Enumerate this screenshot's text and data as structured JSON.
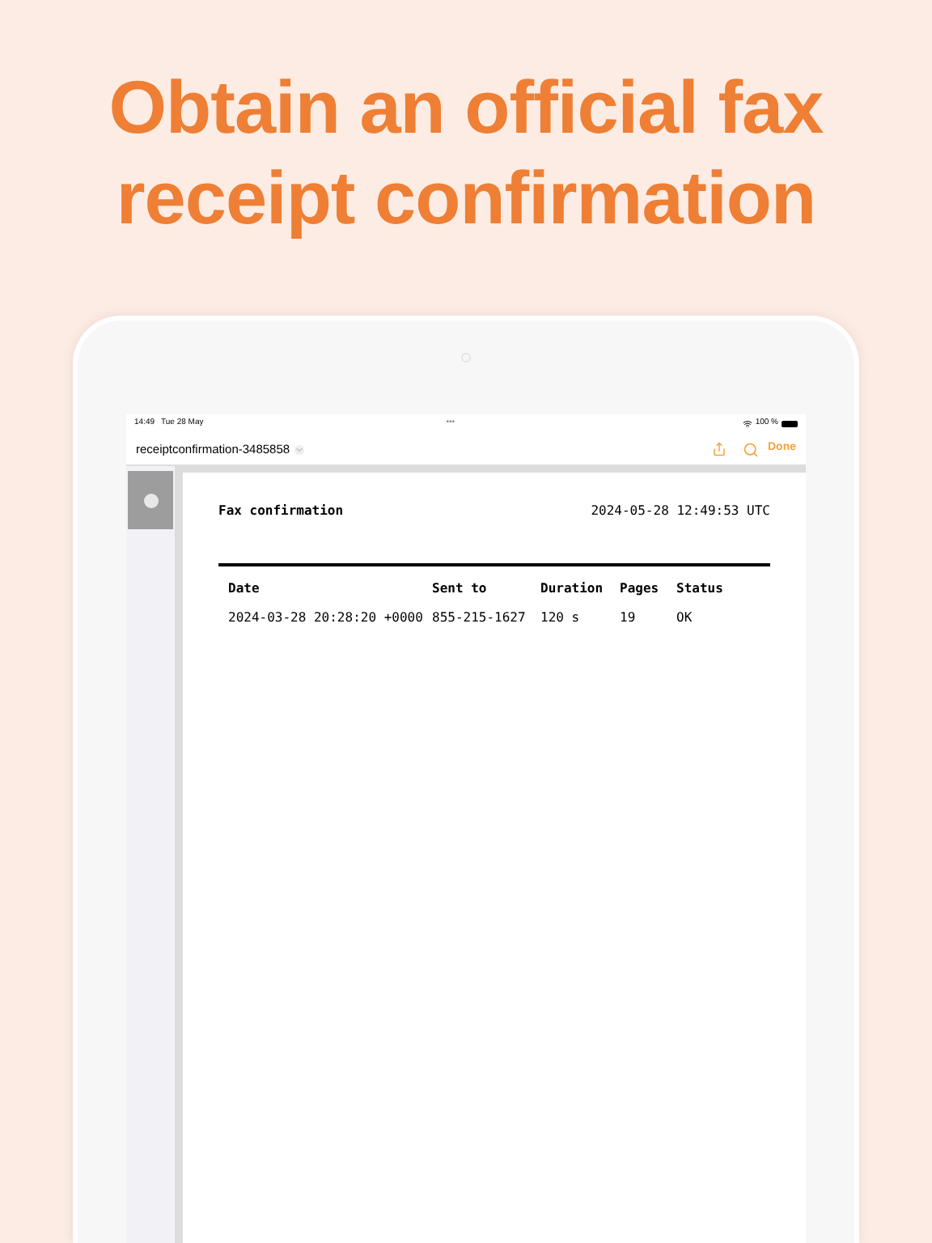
{
  "headline": "Obtain an official fax receipt confirmation",
  "status_bar": {
    "time": "14:49",
    "date": "Tue 28 May",
    "dots": "•••",
    "battery": "100 %"
  },
  "nav_bar": {
    "title": "receiptconfirmation-3485858",
    "done": "Done"
  },
  "document": {
    "title": "Fax confirmation",
    "timestamp": "2024-05-28 12:49:53 UTC",
    "columns": [
      "Date",
      "Sent to",
      "Duration",
      "Pages",
      "Status"
    ],
    "rows": [
      [
        "2024-03-28 20:28:20 +0000",
        "855-215-1627",
        "120 s",
        "19",
        "OK"
      ]
    ]
  }
}
